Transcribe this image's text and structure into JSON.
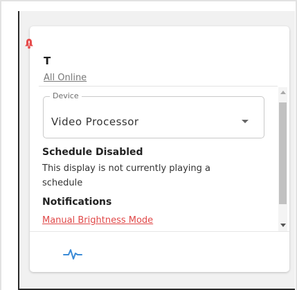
{
  "card": {
    "title": "T",
    "status": "All Online",
    "icons": {
      "alert": "alert-bell-icon",
      "activity": "activity-pulse-icon"
    }
  },
  "device_select": {
    "label": "Device",
    "value": "Video Processor"
  },
  "schedule": {
    "heading": "Schedule Disabled",
    "description": "This display is not currently playing a schedule"
  },
  "notifications": {
    "heading": "Notifications",
    "link": "Manual Brightness Mode"
  },
  "colors": {
    "alert": "#e64c4c",
    "notification_link": "#e04848",
    "activity_icon": "#3a8ad6"
  }
}
